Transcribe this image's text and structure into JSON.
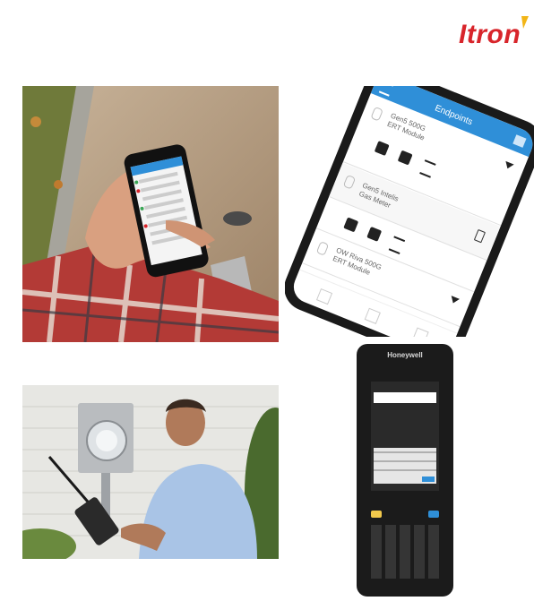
{
  "brand": {
    "logo_text": "Itron"
  },
  "phone_app": {
    "header_title": "Endpoints",
    "endpoints": [
      {
        "line1": "Gen5 500G",
        "line2": "ERT Module"
      },
      {
        "line1": "Gen5 Intelis",
        "line2": "Gas Meter"
      },
      {
        "line1": "OW Riva 500G",
        "line2": "ERT Module"
      }
    ]
  },
  "handheld": {
    "brand": "Honeywell"
  },
  "colors": {
    "itron_red": "#d8252b",
    "itron_yellow": "#f2b517",
    "app_blue": "#2f8fd8"
  },
  "images": {
    "street_phone": "person walking on a path holding a smartphone showing a list app",
    "meter_reader": "man reading a wall-mounted utility meter with a handheld device and antenna",
    "handheld_device": "black rugged handheld computer with touchscreen and physical keypad"
  }
}
